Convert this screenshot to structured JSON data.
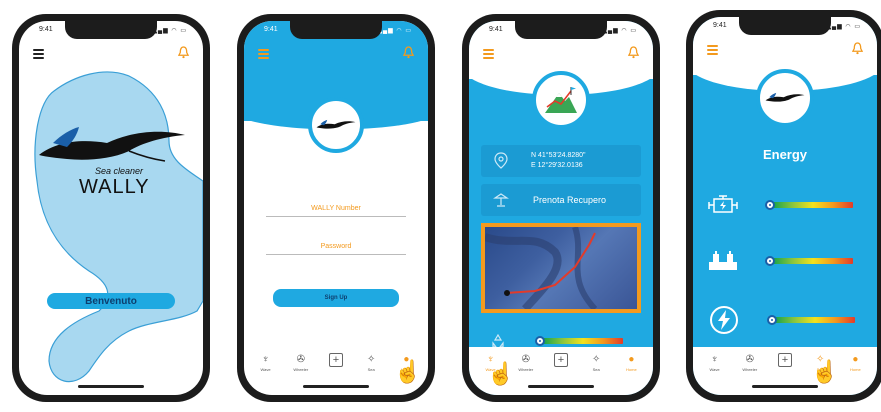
{
  "status_time": "9:41",
  "status_icons": "signal wifi battery",
  "colors": {
    "brand_blue": "#1fa9e1",
    "accent_orange": "#f39a1e",
    "phone_frame": "#1c1c1c"
  },
  "screen1": {
    "brand_tagline": "Sea cleaner",
    "brand_name": "WALLY",
    "welcome_button": "Benvenuto",
    "icons": [
      "menu-icon",
      "bell-icon",
      "manta-logo"
    ]
  },
  "screen2": {
    "field_wally_number": "WALLY Number",
    "field_password": "Password",
    "signup_button": "Sign Up",
    "tabs": [
      {
        "label": "Wave",
        "icon": "wave-icon"
      },
      {
        "label": "Wheeler",
        "icon": "wheel-icon"
      },
      {
        "label": "",
        "icon": "plus-icon"
      },
      {
        "label": "Sea",
        "icon": "compass-icon"
      },
      {
        "label": "Home",
        "icon": "home-icon"
      }
    ]
  },
  "screen3": {
    "coords_line1": "N 41°53'24.8280\"",
    "coords_line2": "E 12°29'32.0136",
    "book_recovery": "Prenota Recupero",
    "icons": [
      "location-pin-icon",
      "mountain-flag-icon",
      "beach-icon",
      "recycle-icon",
      "map-route"
    ]
  },
  "screen4": {
    "title": "Energy",
    "rows": [
      {
        "icon": "engine-icon",
        "level": 0
      },
      {
        "icon": "batteries-icon",
        "level": 0
      },
      {
        "icon": "lightning-icon",
        "level": 0
      }
    ]
  }
}
